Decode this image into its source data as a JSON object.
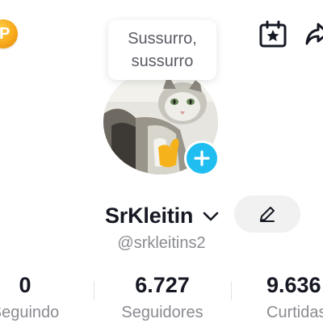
{
  "header": {
    "coin_letter": "P",
    "coin_icon": "coin-icon",
    "calendar_icon": "calendar-star-icon",
    "share_icon": "share-icon"
  },
  "tooltip": {
    "text": "Sussurro,\nsussurro"
  },
  "profile": {
    "avatar_icon": "avatar",
    "add_button_icon": "plus-icon",
    "username": "SrKleitin",
    "handle": "@srkleitins2",
    "edit_icon": "pencil-icon"
  },
  "stats": [
    {
      "value": "0",
      "label": "Seguindo"
    },
    {
      "value": "6.727",
      "label": "Seguidores"
    },
    {
      "value": "9.636",
      "label": "Curtidas"
    }
  ],
  "colors": {
    "accent_blue": "#20bdf0",
    "coin_orange": "#f7a81b",
    "text_primary": "#161823",
    "text_secondary": "#8a8b91"
  }
}
